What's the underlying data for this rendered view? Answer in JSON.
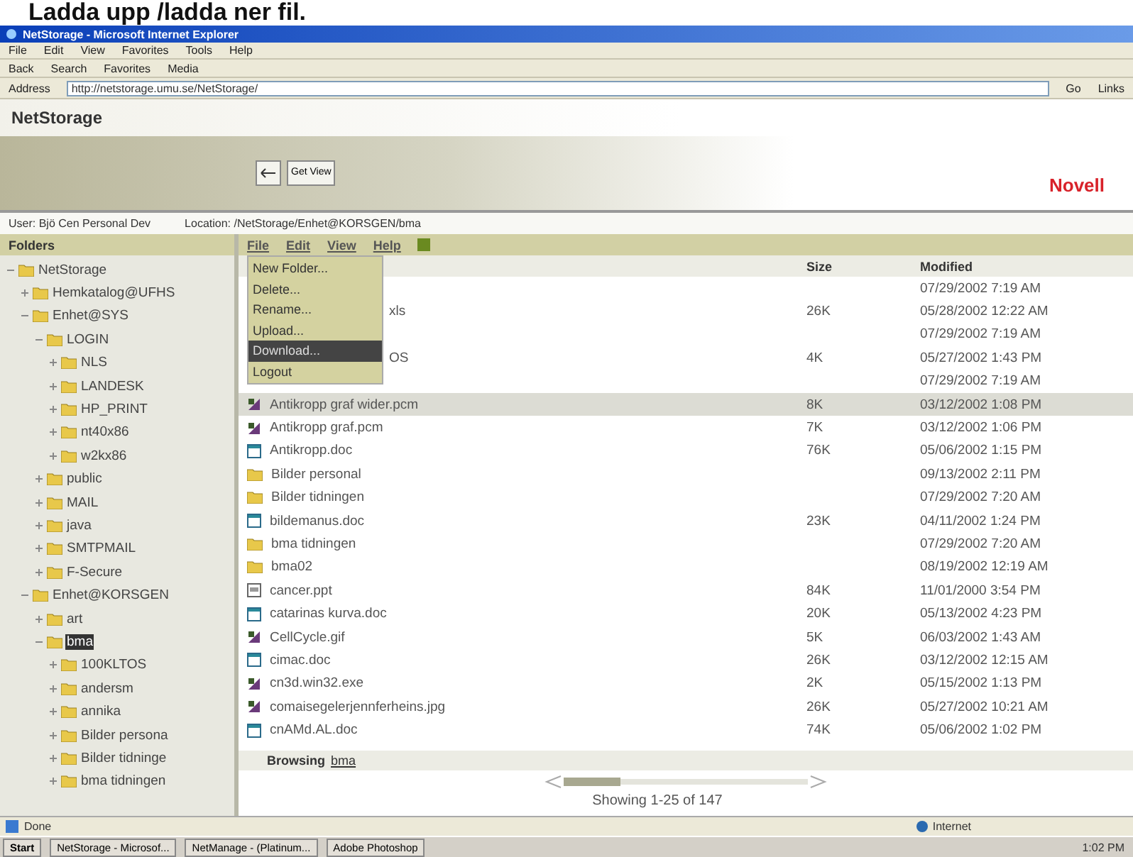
{
  "caption": "Ladda upp /ladda ner fil.",
  "window": {
    "title": "NetStorage - Microsoft Internet Explorer"
  },
  "menu_bar": [
    "File",
    "Edit",
    "View",
    "Favorites",
    "Tools",
    "Help"
  ],
  "toolbar": [
    "Back",
    "Search",
    "Favorites",
    "Media"
  ],
  "address": {
    "label": "Address",
    "value": "http://netstorage.umu.se/NetStorage/",
    "go": "Go",
    "links": "Links"
  },
  "header": {
    "title": "NetStorage",
    "view_button": "Get View",
    "logo": "Novell"
  },
  "info": {
    "user": "User: Bjö Cen Personal Dev",
    "location": "Location: /NetStorage/Enhet@KORSGEN/bma"
  },
  "folders": {
    "title": "Folders",
    "tree": [
      {
        "label": "NetStorage",
        "expanded": true,
        "selected": false,
        "children": [
          {
            "label": "Hemkatalog@UFHS",
            "expanded": false,
            "selected": false
          },
          {
            "label": "Enhet@SYS",
            "expanded": true,
            "selected": false,
            "children": [
              {
                "label": "LOGIN",
                "expanded": true,
                "selected": false,
                "children": [
                  {
                    "label": "NLS",
                    "expanded": false,
                    "selected": false
                  },
                  {
                    "label": "LANDESK",
                    "expanded": false,
                    "selected": false
                  },
                  {
                    "label": "HP_PRINT",
                    "expanded": false,
                    "selected": false
                  },
                  {
                    "label": "nt40x86",
                    "expanded": false,
                    "selected": false
                  },
                  {
                    "label": "w2kx86",
                    "expanded": false,
                    "selected": false
                  }
                ]
              },
              {
                "label": "public",
                "expanded": false,
                "selected": false
              },
              {
                "label": "MAIL",
                "expanded": false,
                "selected": false
              },
              {
                "label": "java",
                "expanded": false,
                "selected": false
              },
              {
                "label": "SMTPMAIL",
                "expanded": false,
                "selected": false
              },
              {
                "label": "F-Secure",
                "expanded": false,
                "selected": false
              }
            ]
          },
          {
            "label": "Enhet@KORSGEN",
            "expanded": true,
            "selected": false,
            "children": [
              {
                "label": "art",
                "expanded": false,
                "selected": false
              },
              {
                "label": "bma",
                "expanded": true,
                "selected": true,
                "children": [
                  {
                    "label": "100KLTOS",
                    "expanded": false,
                    "selected": false
                  },
                  {
                    "label": "andersm",
                    "expanded": false,
                    "selected": false
                  },
                  {
                    "label": "annika",
                    "expanded": false,
                    "selected": false
                  },
                  {
                    "label": "Bilder persona",
                    "expanded": false,
                    "selected": false
                  },
                  {
                    "label": "Bilder tidninge",
                    "expanded": false,
                    "selected": false
                  },
                  {
                    "label": "bma tidningen",
                    "expanded": false,
                    "selected": false
                  }
                ]
              }
            ]
          }
        ]
      }
    ]
  },
  "file_menu": [
    "File",
    "Edit",
    "View",
    "Help"
  ],
  "dropdown": [
    {
      "label": "New Folder...",
      "selected": false
    },
    {
      "label": "Delete...",
      "selected": false
    },
    {
      "label": "Rename...",
      "selected": false
    },
    {
      "label": "Upload...",
      "selected": false
    },
    {
      "label": "Download...",
      "selected": true
    },
    {
      "label": "Logout",
      "selected": false
    }
  ],
  "table": {
    "columns": [
      "Size",
      "Modified"
    ],
    "rows": [
      {
        "kind": "hidden",
        "modified": "07/29/2002 7:19 AM",
        "selected": false
      },
      {
        "kind": "hidden",
        "name": "xls",
        "size": "26K",
        "modified": "05/28/2002 12:22 AM",
        "selected": false
      },
      {
        "kind": "hidden",
        "modified": "07/29/2002 7:19 AM",
        "selected": false
      },
      {
        "kind": "hidden",
        "name": "OS",
        "size": "4K",
        "modified": "05/27/2002 1:43 PM",
        "selected": false
      },
      {
        "kind": "hidden",
        "modified": "07/29/2002 7:19 AM",
        "selected": false
      },
      {
        "kind": "image",
        "name": "Antikropp graf wider.pcm",
        "size": "8K",
        "modified": "03/12/2002 1:08 PM",
        "selected": true
      },
      {
        "kind": "image",
        "name": "Antikropp graf.pcm",
        "size": "7K",
        "modified": "03/12/2002 1:06 PM",
        "selected": false
      },
      {
        "kind": "doc",
        "name": "Antikropp.doc",
        "size": "76K",
        "modified": "05/06/2002 1:15 PM",
        "selected": false
      },
      {
        "kind": "folder",
        "name": "Bilder personal",
        "modified": "09/13/2002 2:11 PM",
        "selected": false
      },
      {
        "kind": "folder",
        "name": "Bilder tidningen",
        "modified": "07/29/2002 7:20 AM",
        "selected": false
      },
      {
        "kind": "doc",
        "name": "bildemanus.doc",
        "size": "23K",
        "modified": "04/11/2002 1:24 PM",
        "selected": false
      },
      {
        "kind": "folder",
        "name": "bma tidningen",
        "modified": "07/29/2002 7:20 AM",
        "selected": false
      },
      {
        "kind": "folder",
        "name": "bma02",
        "modified": "08/19/2002 12:19 AM",
        "selected": false
      },
      {
        "kind": "ppt",
        "name": "cancer.ppt",
        "size": "84K",
        "modified": "11/01/2000 3:54 PM",
        "selected": false
      },
      {
        "kind": "doc",
        "name": "catarinas kurva.doc",
        "size": "20K",
        "modified": "05/13/2002 4:23 PM",
        "selected": false
      },
      {
        "kind": "image",
        "name": "CellCycle.gif",
        "size": "5K",
        "modified": "06/03/2002 1:43 AM",
        "selected": false
      },
      {
        "kind": "doc",
        "name": "cimac.doc",
        "size": "26K",
        "modified": "03/12/2002 12:15 AM",
        "selected": false
      },
      {
        "kind": "image",
        "name": "cn3d.win32.exe",
        "size": "2K",
        "modified": "05/15/2002 1:13 PM",
        "selected": false
      },
      {
        "kind": "image",
        "name": "comaisegelerjennferheins.jpg",
        "size": "26K",
        "modified": "05/27/2002 10:21 AM",
        "selected": false
      },
      {
        "kind": "doc",
        "name": "cnAMd.AL.doc",
        "size": "74K",
        "modified": "05/06/2002 1:02 PM",
        "selected": false
      }
    ]
  },
  "browsing": {
    "label": "Browsing",
    "folder": "bma"
  },
  "paging": "Showing 1-25 of 147",
  "status_bar": {
    "text": "Done",
    "zone": "Internet"
  },
  "taskbar": {
    "start": "Start",
    "tasks": [
      "NetStorage - Microsof...",
      "NetManage - (Platinum...",
      "Adobe Photoshop"
    ],
    "clock": "1:02 PM"
  }
}
